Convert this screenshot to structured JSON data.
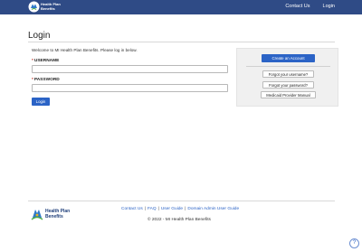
{
  "header": {
    "logo_line1": "Health Plan",
    "logo_line2": "Benefits",
    "nav": [
      {
        "label": "Contact Us"
      },
      {
        "label": "Login"
      }
    ]
  },
  "page": {
    "title": "Login",
    "welcome": "Welcome to MI Health Plan Benefits. Please log in below."
  },
  "form": {
    "required_marker": "*",
    "username_label": "USERNAME",
    "username_value": "",
    "password_label": "PASSWORD",
    "password_value": "",
    "login_button": "Login"
  },
  "sidebar": {
    "create_account": "Create an Account",
    "links": [
      {
        "label": "Forgot your username?"
      },
      {
        "label": "Forgot your password?"
      },
      {
        "label": "Medicaid Provider Manual"
      }
    ]
  },
  "footer": {
    "logo_line1": "Health Plan",
    "logo_line2": "Benefits",
    "links": [
      {
        "label": "Contact Us"
      },
      {
        "label": "FAQ"
      },
      {
        "label": "User Guide"
      },
      {
        "label": "Domain Admin User Guide"
      }
    ],
    "separator": "|",
    "copyright": "© 2022 - MI Health Plan Benefits",
    "help_icon": "?"
  },
  "colors": {
    "header_bg": "#2f4b86",
    "primary_button": "#2b63c6",
    "required": "#c0392b"
  }
}
